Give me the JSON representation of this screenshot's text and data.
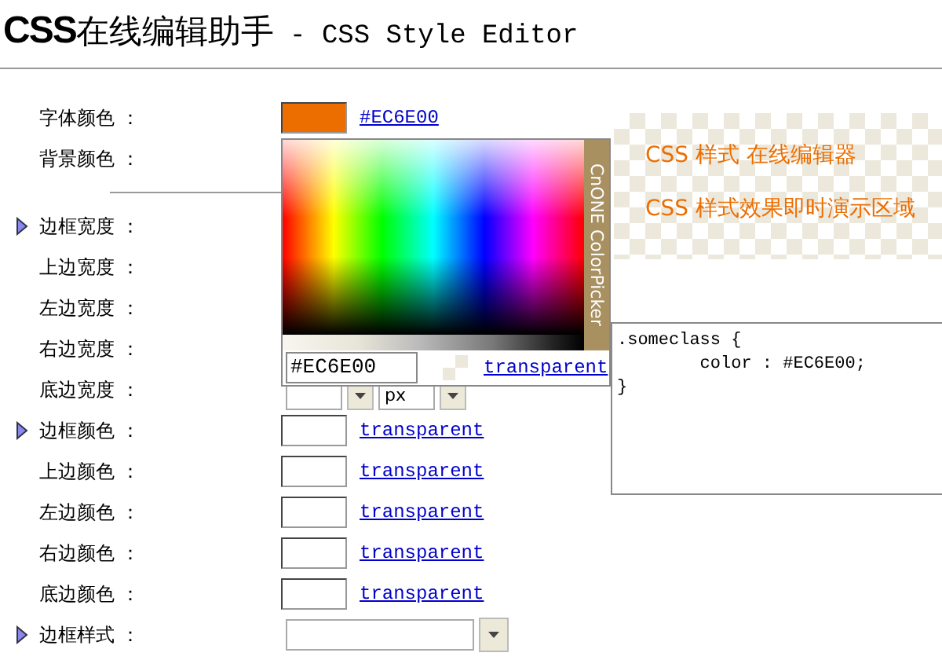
{
  "header": {
    "brand": "CSS",
    "title": "在线编辑助手",
    "subtitle": " - CSS Style Editor"
  },
  "form": [
    {
      "kind": "color",
      "label": "字体颜色 ：",
      "color": "#ec6e00",
      "link": "#EC6E00"
    },
    {
      "kind": "color",
      "label": "背景颜色 ："
    },
    {
      "kind": "width",
      "label": "边框宽度 ：",
      "expander": true
    },
    {
      "kind": "width",
      "label": "上边宽度 ："
    },
    {
      "kind": "width",
      "label": "左边宽度 ："
    },
    {
      "kind": "width",
      "label": "右边宽度 ："
    },
    {
      "kind": "width",
      "label": "底边宽度 ：",
      "unit": "px"
    },
    {
      "kind": "color",
      "label": "边框颜色 ：",
      "expander": true,
      "link": "transparent"
    },
    {
      "kind": "color",
      "label": "上边颜色 ：",
      "link": "transparent"
    },
    {
      "kind": "color",
      "label": "左边颜色 ：",
      "link": "transparent"
    },
    {
      "kind": "color",
      "label": "右边颜色 ：",
      "link": "transparent"
    },
    {
      "kind": "color",
      "label": "底边颜色 ：",
      "link": "transparent"
    },
    {
      "kind": "select",
      "label": "边框样式 ：",
      "expander": true
    }
  ],
  "picker": {
    "title": "CnONE ColorPicker",
    "value": "#EC6E00",
    "link": "transparent"
  },
  "preview": {
    "lines": [
      "CSS 样式 在线编辑器",
      "CSS 样式效果即时演示区域"
    ]
  },
  "code": {
    "lines": [
      ".someclass {",
      "        color : #EC6E00;",
      "}"
    ]
  }
}
